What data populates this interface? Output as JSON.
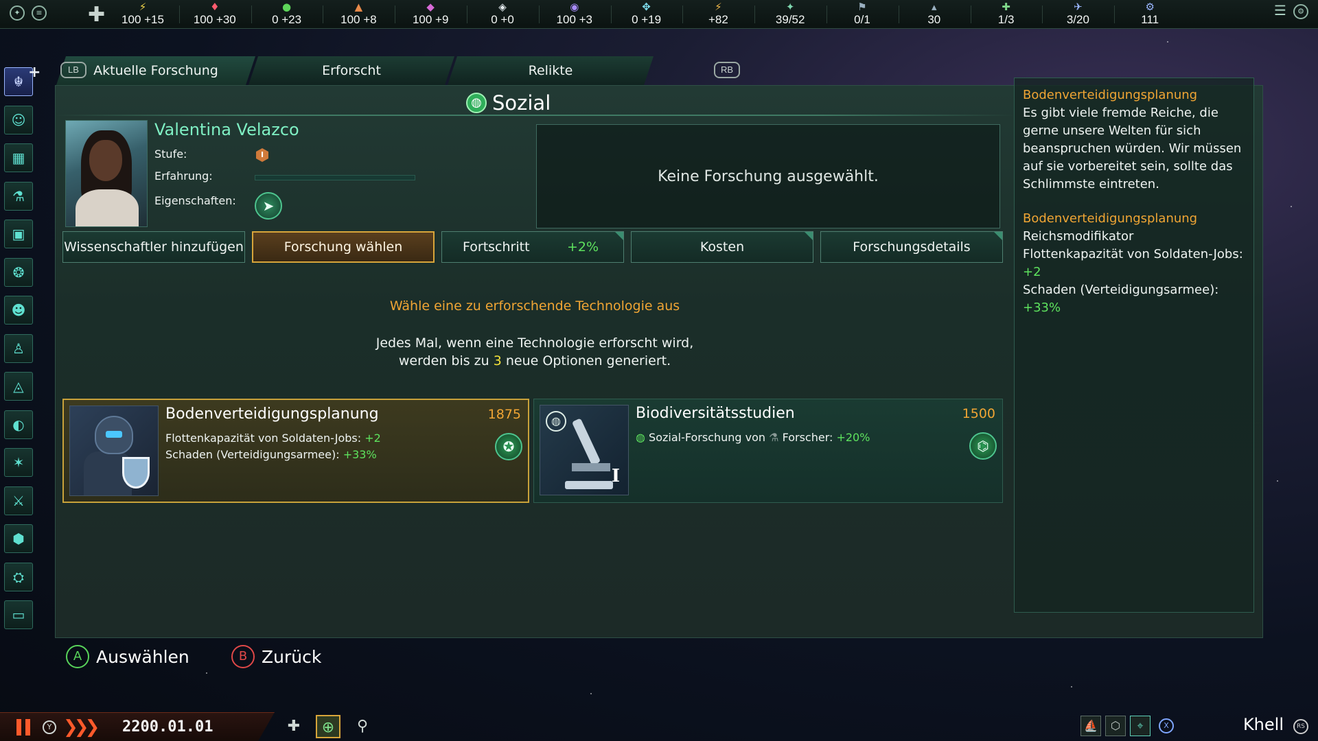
{
  "topbar": {
    "resources": [
      {
        "icon": "energy-icon",
        "glyph": "⚡",
        "color": "#f0d44a",
        "value": "100 +15"
      },
      {
        "icon": "minerals-icon",
        "glyph": "♦",
        "color": "#ff5b6e",
        "value": "100 +30"
      },
      {
        "icon": "food-icon",
        "glyph": "●",
        "color": "#5ed65a",
        "value": "0 +23"
      },
      {
        "icon": "alloys-icon",
        "glyph": "▲",
        "color": "#e88a4a",
        "value": "100 +8"
      },
      {
        "icon": "consumer-goods-icon",
        "glyph": "◆",
        "color": "#d66ad6",
        "value": "100 +9"
      },
      {
        "icon": "influence-icon",
        "glyph": "◈",
        "color": "#e6eef2",
        "value": "0 +0"
      },
      {
        "icon": "unity-icon",
        "glyph": "◉",
        "color": "#a98cff",
        "value": "100 +3"
      },
      {
        "icon": "research-icon",
        "glyph": "✥",
        "color": "#7fe0f0",
        "value": "0 +19"
      },
      {
        "icon": "trade-icon",
        "glyph": "⚡",
        "color": "#f0b84a",
        "value": "+82"
      },
      {
        "icon": "planets-icon",
        "glyph": "✦",
        "color": "#7fd8b0",
        "value": "39/52"
      },
      {
        "icon": "starbase-icon",
        "glyph": "⚑",
        "color": "#9ab0c0",
        "value": "0/1"
      },
      {
        "icon": "empire-size-icon",
        "glyph": "▴",
        "color": "#9ab0c0",
        "value": "30"
      },
      {
        "icon": "envoys-icon",
        "glyph": "✚",
        "color": "#7fd88a",
        "value": "1/3"
      },
      {
        "icon": "fleet-icon",
        "glyph": "✈",
        "color": "#9ab6ff",
        "value": "3/20"
      },
      {
        "icon": "naval-capacity-icon",
        "glyph": "⚙",
        "color": "#9ab6ff",
        "value": "111"
      }
    ]
  },
  "tabs": {
    "lb": "LB",
    "rb": "RB",
    "current": "Aktuelle Forschung",
    "researched": "Erforscht",
    "relics": "Relikte"
  },
  "panel": {
    "category": "Sozial",
    "scientist": {
      "name": "Valentina Velazco",
      "level_label": "Stufe:",
      "level_value": "I",
      "xp_label": "Erfahrung:",
      "xp_fraction": 0.0,
      "traits_label": "Eigenschaften:"
    },
    "no_research": "Keine Forschung ausgewählt.",
    "buttons": {
      "add_scientist": "Wissenschaftler hinzufügen",
      "choose_research": "Forschung wählen",
      "progress": "Fortschritt",
      "progress_pct": "+2%",
      "cost": "Kosten",
      "details": "Forschungsdetails"
    },
    "prompt_title": "Wähle eine zu erforschende Technologie aus",
    "prompt_line1": "Jedes Mal, wenn eine Technologie erforscht wird,",
    "prompt_line2_pre": "werden bis zu ",
    "prompt_line2_num": "3",
    "prompt_line2_post": " neue Optionen generiert.",
    "options": [
      {
        "title": "Bodenverteidigungsplanung",
        "cost": "1875",
        "line1_text": "Flottenkapazität von Soldaten-Jobs: ",
        "line1_val": "+2",
        "line2_text": "Schaden (Verteidigungsarmee): ",
        "line2_val": "+33%"
      },
      {
        "title": "Biodiversitätsstudien",
        "cost": "1500",
        "tier": "I",
        "line1_text_a": "Sozial-Forschung von ",
        "line1_text_b": "Forscher: ",
        "line1_val": "+20%"
      }
    ]
  },
  "info": {
    "title1": "Bodenverteidigungsplanung",
    "desc": "Es gibt viele fremde Reiche, die gerne unsere Welten für sich beanspruchen würden. Wir müssen auf sie vorbereitet sein, sollte das Schlimmste eintreten.",
    "title2": "Bodenverteidigungsplanung",
    "modifier": "Reichsmodifikator",
    "mod1": "Flottenkapazität von Soldaten-Jobs:",
    "mod1_val": "+2",
    "mod2": "Schaden (Verteidigungsarmee):",
    "mod2_val": "+33%"
  },
  "hints": {
    "a_btn": "A",
    "a_label": "Auswählen",
    "b_btn": "B",
    "b_label": "Zurück"
  },
  "bottombar": {
    "y_btn": "Y",
    "speed": "❯❯❯",
    "date": "2200.01.01",
    "x_btn": "X",
    "empire": "Khell",
    "rs_btn": "RS"
  },
  "colors": {
    "accent_green": "#5ee35e",
    "accent_orange": "#f0a534",
    "accent_teal": "#7ff0c4",
    "selected_gold": "#d8a53a"
  }
}
